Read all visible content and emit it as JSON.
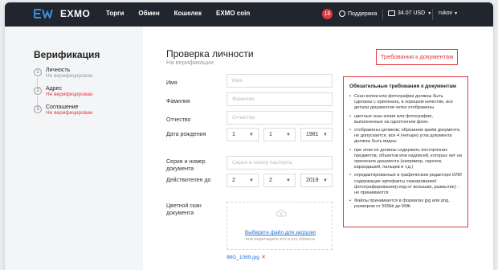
{
  "topbar": {
    "logo_text": "EXMO",
    "nav": [
      "Торги",
      "Обмен",
      "Кошелек",
      "EXMO coin"
    ],
    "notifications_count": "16",
    "support_label": "Поддержка",
    "balance": "34.07 USD",
    "username": "rukov"
  },
  "sidebar": {
    "title": "Верификация",
    "steps": [
      {
        "num": "1",
        "name": "Личность",
        "status": "Не верифицирован"
      },
      {
        "num": "2",
        "name": "Адрес",
        "status": "Не верифицирован"
      },
      {
        "num": "3",
        "name": "Соглашение",
        "status": "Не верифицирован"
      }
    ]
  },
  "main": {
    "title": "Проверка личности",
    "subtitle": "На верификации",
    "requirements_button": "Требования к документам"
  },
  "form": {
    "first_name_label": "Имя",
    "first_name_placeholder": "Имя",
    "last_name_label": "Фамилия",
    "last_name_placeholder": "Фамилия",
    "middle_name_label": "Отчество",
    "middle_name_placeholder": "Отчество",
    "birth_label": "Дата рождения",
    "birth_day": "1",
    "birth_month": "1",
    "birth_year": "1981",
    "passport_label": "Серия и номер документа",
    "passport_placeholder": "Серия и номер паспорта",
    "valid_label": "Действителен до",
    "valid_day": "2",
    "valid_month": "2",
    "valid_year": "2019",
    "scan_label": "Цветной скан документа",
    "upload_link": "Выберите файл для загрузки",
    "upload_hint": "или перетащите его в эту область",
    "uploaded_file": "IMG_1069.jpg",
    "remove_symbol": "✕"
  },
  "requirements": {
    "title": "Обязательные требования к документам",
    "items": [
      "Скан-копии или фотографии должны быть сделаны с оригинала, в хорошем качестве, все детали документов четко отображены.",
      "цветные скан копии или фотографии, выполненные на однотонном фоне.",
      "отображены целиком; обрезание краёв документа не допускается, все 4 (четыре) угла документа должны быть видны",
      "при этом не должны содержать посторонних предметов, объектов или надписей, которых нет на оригинале документа (например, скрепок, карандашей, пальцев и т.д.)",
      "отредактированные в графическом редакторе ИЛИ содержащие артефакты сканирования/фотографирования(след от вспышки, размытие) - не принимаются",
      "Файлы принимаются в форматах jpg или png, размером от 500kb до 5Mb"
    ]
  },
  "colors": {
    "accent_red": "#e0393e",
    "topbar_bg": "#21262e",
    "link_blue": "#2a6fd6",
    "logo_blue": "#3b8ee6"
  }
}
